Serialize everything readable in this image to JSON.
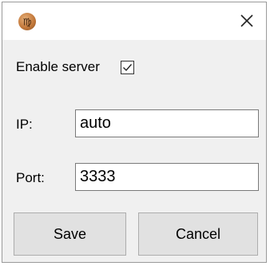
{
  "app_icon": "virgo-sign-icon",
  "close_icon": "close-icon",
  "enable_server": {
    "label": "Enable server",
    "checked": true
  },
  "ip": {
    "label": "IP:",
    "value": "auto"
  },
  "port": {
    "label": "Port:",
    "value": "3333"
  },
  "buttons": {
    "save": "Save",
    "cancel": "Cancel"
  }
}
